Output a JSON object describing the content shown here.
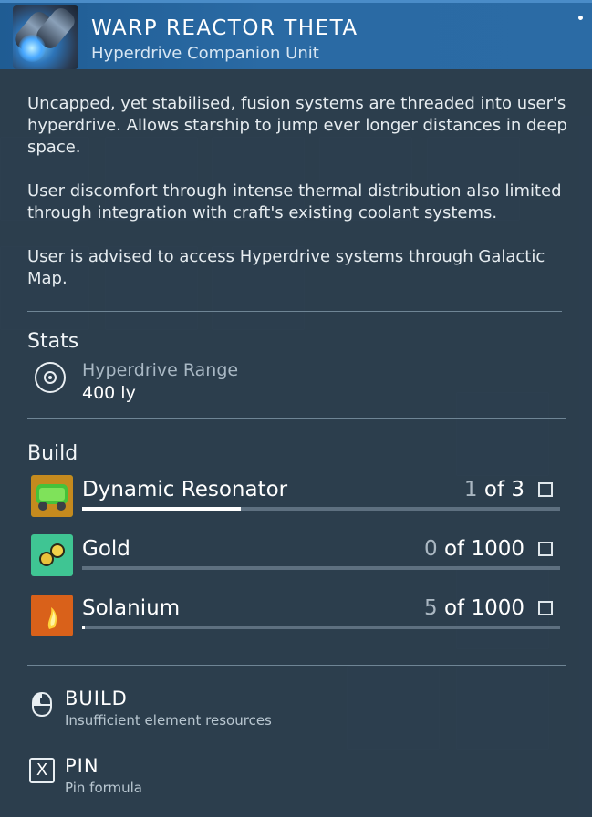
{
  "header": {
    "title": "WARP REACTOR THETA",
    "subtitle": "Hyperdrive Companion Unit",
    "icon": "warp-reactor-icon"
  },
  "description": [
    "Uncapped, yet stabilised, fusion systems are threaded into user's hyperdrive. Allows starship to jump ever longer distances in deep space.",
    "User discomfort through intense thermal distribution also limited through integration with craft's existing coolant systems.",
    "User is advised to access Hyperdrive systems through Galactic Map."
  ],
  "stats": {
    "title": "Stats",
    "items": [
      {
        "label": "Hyperdrive Range",
        "value": "400 ly",
        "icon": "target-icon"
      }
    ]
  },
  "build": {
    "title": "Build",
    "resources": [
      {
        "name": "Dynamic Resonator",
        "have": "1",
        "of_text": "of 3",
        "progress": 0.333,
        "icon": "dynamic-resonator-icon",
        "color": "#3fa43a"
      },
      {
        "name": "Gold",
        "have": "0",
        "of_text": "of 1000",
        "progress": 0.0,
        "icon": "gold-icon",
        "color": "#3dbd8f"
      },
      {
        "name": "Solanium",
        "have": "5",
        "of_text": "of 1000",
        "progress": 0.005,
        "icon": "solanium-icon",
        "color": "#e0691c"
      }
    ]
  },
  "actions": {
    "build_label": "BUILD",
    "build_sub": "Insufficient element resources",
    "pin_key": "X",
    "pin_label": "PIN",
    "pin_sub": "Pin formula"
  }
}
